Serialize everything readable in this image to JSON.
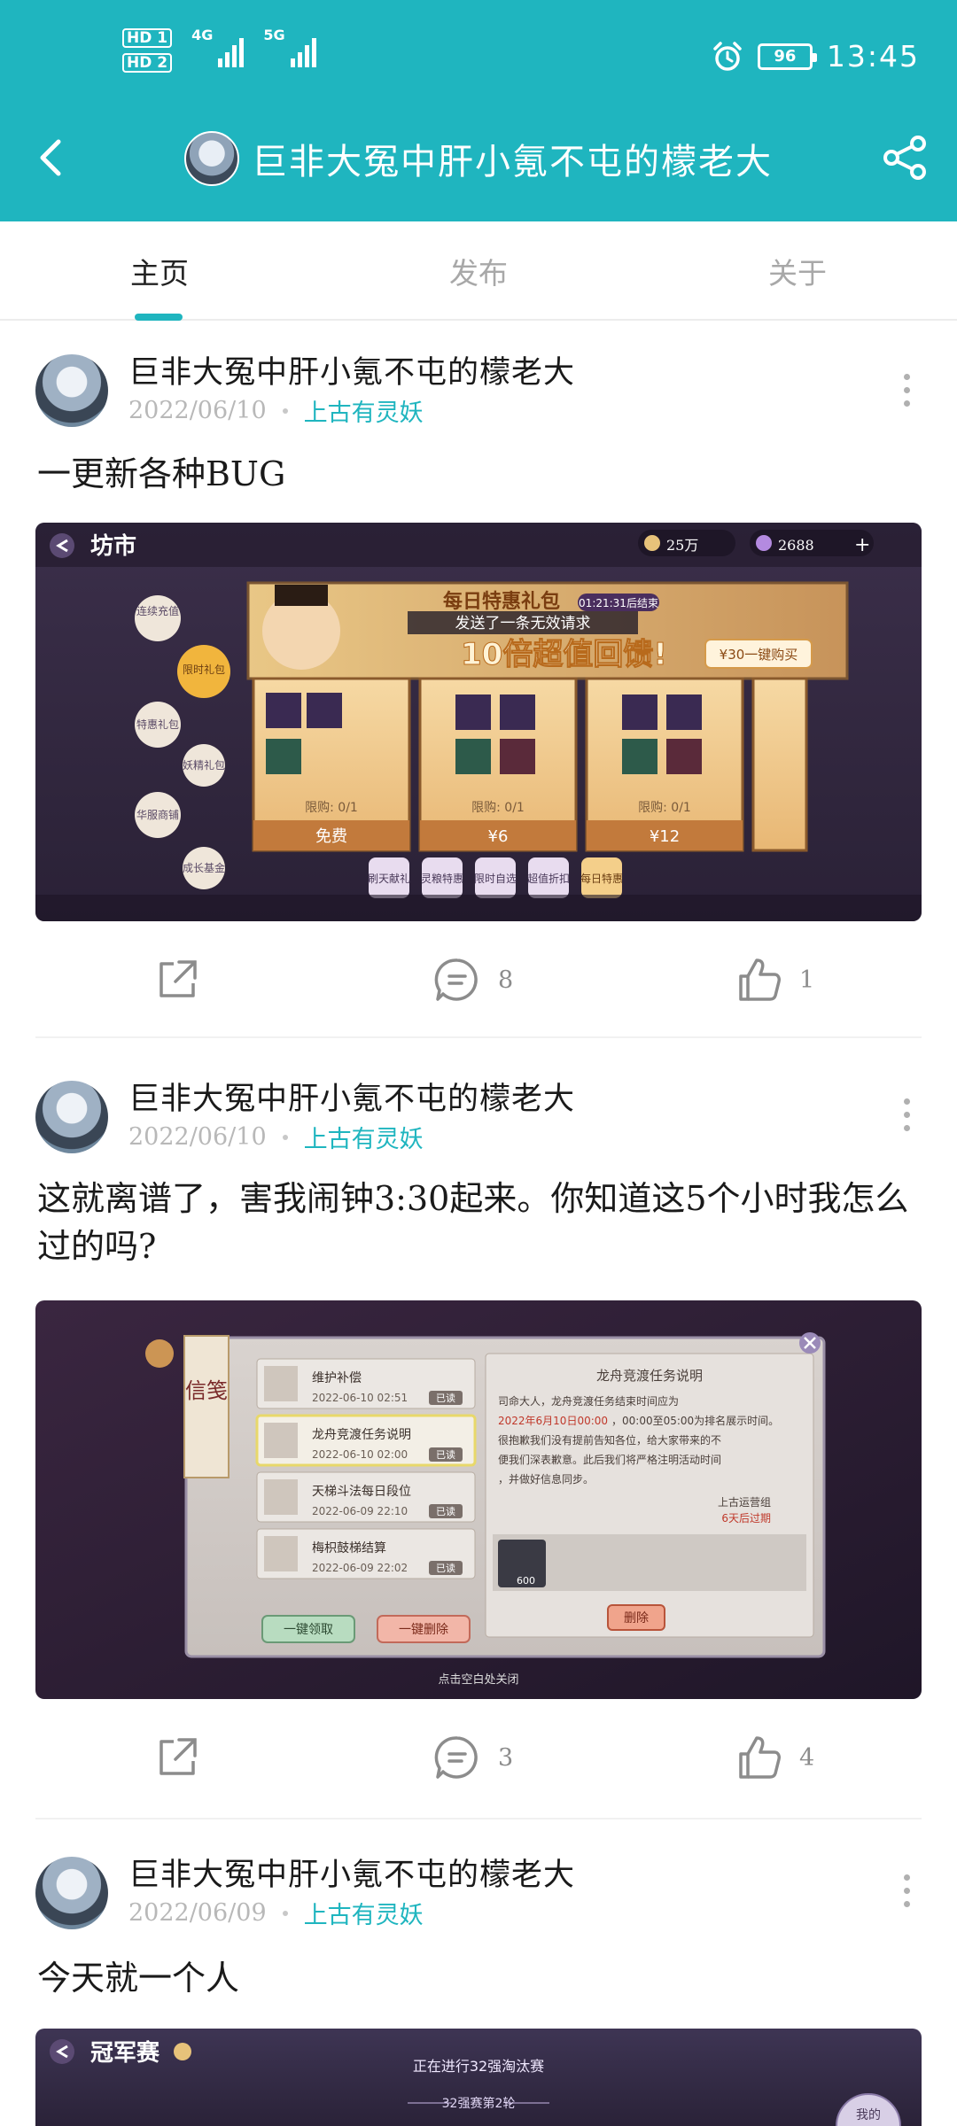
{
  "status_bar": {
    "hd1": "HD 1",
    "hd2": "HD 2",
    "net1": "4G",
    "net2": "5G",
    "battery": "96",
    "time": "13:45",
    "icons": [
      "signal-icon",
      "alarm-icon",
      "battery-icon"
    ]
  },
  "header": {
    "title": "巨非大冤中肝小氪不屯的檬老大",
    "back_icon": "chevron-left-icon",
    "share_icon": "share-icon",
    "background": "#1fb5bf"
  },
  "tabs": [
    {
      "label": "主页",
      "active": true
    },
    {
      "label": "发布",
      "active": false
    },
    {
      "label": "关于",
      "active": false
    }
  ],
  "accent_color": "#1fb5bf",
  "posts": [
    {
      "author": "巨非大冤中肝小氪不屯的檬老大",
      "date": "2022/06/10",
      "board": "上古有灵妖",
      "text": "一更新各种BUG",
      "comments": "8",
      "likes": "1",
      "image": {
        "shop_title": "坊市",
        "currency1": "25万",
        "currency2": "2688",
        "banner_title": "每日特惠礼包",
        "banner_timer": "01:21:31后结束",
        "error_text": "发送了一条无效请求",
        "banner_big": "10倍超值回馈!",
        "bundle_button": "¥30一键购买",
        "side_menu": [
          "连续充值",
          "限时礼包",
          "特惠礼包",
          "妖精礼包",
          "华服商铺",
          "成长基金"
        ],
        "cards": [
          {
            "limit": "限购: 0/1",
            "price": "免费"
          },
          {
            "limit": "限购: 0/1",
            "price": "¥6"
          },
          {
            "limit": "限购: 0/1",
            "price": "¥12"
          }
        ],
        "bottom_tabs": [
          "刷天献礼",
          "灵粮特惠",
          "限时自选",
          "超值折扣",
          "每日特惠"
        ]
      }
    },
    {
      "author": "巨非大冤中肝小氪不屯的檬老大",
      "date": "2022/06/10",
      "board": "上古有灵妖",
      "text": "这就离谱了，害我闹钟3:30起来。你知道这5个小时我怎么过的吗?",
      "comments": "3",
      "likes": "4",
      "image": {
        "mail_title": "信笺",
        "mails": [
          {
            "title": "维护补偿",
            "date": "2022-06-10 02:51",
            "status": "已读"
          },
          {
            "title": "龙舟竞渡任务说明",
            "date": "2022-06-10 02:00",
            "status": "已读"
          },
          {
            "title": "天梯斗法每日段位",
            "date": "2022-06-09 22:10",
            "status": "已读"
          },
          {
            "title": "梅枳鼓梯结算",
            "date": "2022-06-09 22:02",
            "status": "已读"
          }
        ],
        "claim_all": "一键领取",
        "delete_all": "一键删除",
        "detail_title": "龙舟竞渡任务说明",
        "detail_body_1": "司命大人，龙舟竞渡任务结束时间应为",
        "detail_red": "2022年6月10日00:00",
        "detail_body_2": "，00:00至05:00为排名展示时间。",
        "detail_body_3": "很抱歉我们没有提前告知各位，给大家带来的不",
        "detail_body_4": "便我们深表歉意。此后我们将严格注明活动时间",
        "detail_body_5": "，并做好信息同步。",
        "sender": "上古运营组",
        "expire": "6天后过期",
        "attach_count": "600",
        "delete_button": "删除",
        "close_hint": "点击空白处关闭"
      }
    },
    {
      "author": "巨非大冤中肝小氪不屯的檬老大",
      "date": "2022/06/09",
      "board": "上古有灵妖",
      "text": "今天就一个人",
      "image": {
        "title": "冠军赛",
        "progress": "正在进行32强淘汰赛",
        "round": "32强赛第2轮",
        "my_label": "我的"
      }
    }
  ]
}
